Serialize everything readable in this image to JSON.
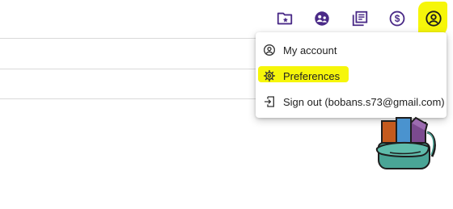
{
  "toolbar": {
    "icons": [
      "folder-star-icon",
      "face-team-icon",
      "library-books-icon",
      "dollar-circle-icon",
      "account-circle-icon"
    ]
  },
  "account_menu": {
    "items": [
      {
        "label": "My account",
        "icon": "account-circle-icon"
      },
      {
        "label": "Preferences",
        "icon": "gear-icon",
        "highlighted": true
      },
      {
        "label": "Sign out (bobans.s73@gmail.com)",
        "icon": "sign-out-icon"
      }
    ]
  },
  "colors": {
    "icon": "#4a2a87",
    "highlight": "#f6f60a",
    "divider": "#d9d9d9"
  }
}
